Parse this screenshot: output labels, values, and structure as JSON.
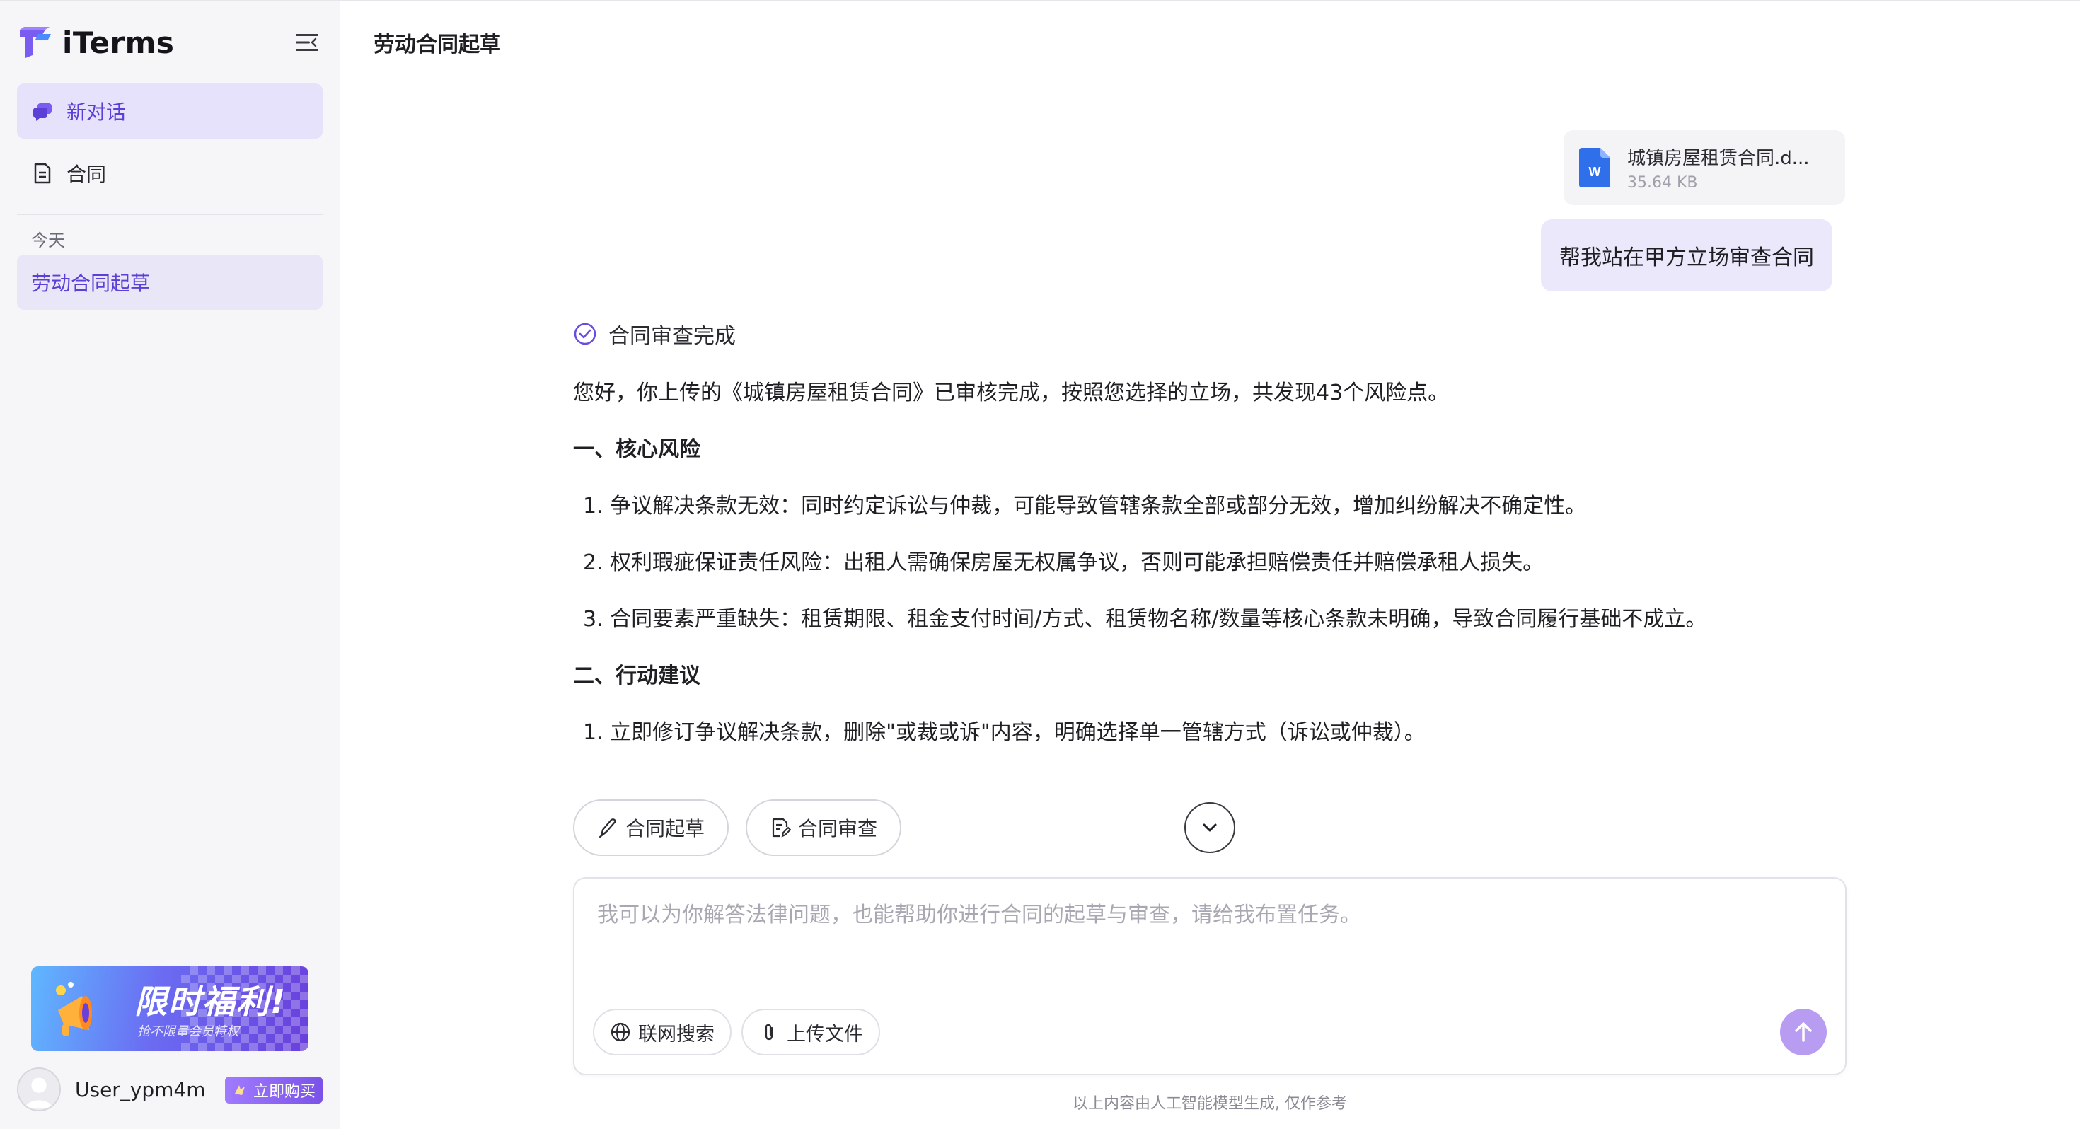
{
  "brand": {
    "name": "iTerms"
  },
  "sidebar": {
    "new_chat_label": "新对话",
    "contract_label": "合同",
    "section_today": "今天",
    "history": [
      {
        "label": "劳动合同起草"
      }
    ],
    "promo": {
      "title": "限时福利!",
      "subtitle": "抢不限量会员特权"
    },
    "user": {
      "name": "User_ypm4m",
      "buy_label": "立即购买"
    }
  },
  "main": {
    "title": "劳动合同起草",
    "file": {
      "name": "城镇房屋租赁合同.d...",
      "size": "35.64 KB",
      "type_letter": "W"
    },
    "user_message": "帮我站在甲方立场审查合同",
    "answer": {
      "status": "合同审查完成",
      "intro": "您好，你上传的《城镇房屋租赁合同》已审核完成，按照您选择的立场，共发现43个风险点。",
      "section1_title": "一、核心风险",
      "section1_items": [
        "1. 争议解决条款无效：同时约定诉讼与仲裁，可能导致管辖条款全部或部分无效，增加纠纷解决不确定性。",
        "2. 权利瑕疵保证责任风险：出租人需确保房屋无权属争议，否则可能承担赔偿责任并赔偿承租人损失。",
        "3. 合同要素严重缺失：租赁期限、租金支付时间/方式、租赁物名称/数量等核心条款未明确，导致合同履行基础不成立。"
      ],
      "section2_title": "二、行动建议",
      "section2_items": [
        "1. 立即修订争议解决条款，删除\"或裁或诉\"内容，明确选择单一管辖方式（诉讼或仲裁）。"
      ]
    },
    "quick_actions": {
      "draft_label": "合同起草",
      "review_label": "合同审查"
    },
    "composer": {
      "placeholder": "我可以为你解答法律问题，也能帮助你进行合同的起草与审查，请给我布置任务。",
      "web_search_label": "联网搜索",
      "upload_label": "上传文件"
    },
    "disclaimer": "以上内容由人工智能模型生成, 仅作参考"
  },
  "colors": {
    "accent": "#5b3fd6",
    "accent_light": "#e7e2fb",
    "send_button": "#b79cf2",
    "word_blue": "#2f6fea"
  },
  "icons": [
    "logo-icon",
    "collapse-sidebar-icon",
    "chat-bubbles-icon",
    "document-icon",
    "megaphone-icon",
    "avatar-icon",
    "vip-icon",
    "word-file-icon",
    "check-circle-icon",
    "pen-icon",
    "doc-edit-icon",
    "chevron-down-icon",
    "globe-icon",
    "paperclip-icon",
    "arrow-up-icon"
  ]
}
